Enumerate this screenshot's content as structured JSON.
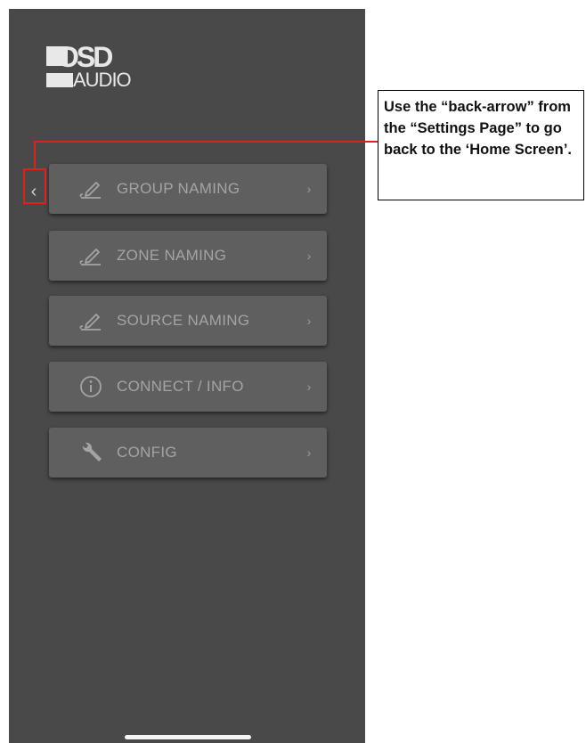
{
  "logo": {
    "line1": "OSD",
    "line2": "AUDIO"
  },
  "nav": {
    "back_glyph": "‹"
  },
  "menu": [
    {
      "label": "GROUP NAMING",
      "icon": "pencil-icon",
      "chevron": "›"
    },
    {
      "label": "ZONE NAMING",
      "icon": "pencil-icon",
      "chevron": "›"
    },
    {
      "label": "SOURCE NAMING",
      "icon": "pencil-icon",
      "chevron": "›"
    },
    {
      "label": "CONNECT / INFO",
      "icon": "info-icon",
      "chevron": "›"
    },
    {
      "label": "CONFIG",
      "icon": "wrench-icon",
      "chevron": "›"
    }
  ],
  "callout": {
    "text": "Use the “back-arrow” from the “Settings Page” to go back to the ‘Home Screen’."
  },
  "colors": {
    "screen_bg": "#494949",
    "button_bg": "#5f5f5f",
    "button_text": "#a4a4a4",
    "highlight": "#e0201c"
  }
}
